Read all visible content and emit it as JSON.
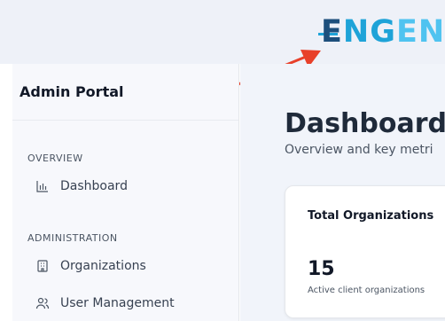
{
  "brand": {
    "logo_part1": "E",
    "logo_part2": "NG",
    "logo_part3": "EN"
  },
  "sidebar": {
    "title": "Admin Portal",
    "sections": [
      {
        "label": "OVERVIEW",
        "items": [
          {
            "label": "Dashboard",
            "icon": "bar-chart-icon"
          }
        ]
      },
      {
        "label": "ADMINISTRATION",
        "items": [
          {
            "label": "Organizations",
            "icon": "building-icon"
          },
          {
            "label": "User Management",
            "icon": "users-icon"
          }
        ]
      }
    ]
  },
  "main": {
    "title": "Dashboard",
    "subtitle": "Overview and key metri",
    "cards": [
      {
        "title": "Total Organizations",
        "value": "15",
        "caption": "Active client organizations"
      }
    ]
  },
  "annotation": {
    "arrow_color": "#e8402a"
  },
  "colors": {
    "accent": "#1ea3d8",
    "brand_dark": "#1d4f7c",
    "sidebar_bg": "#f7f8fc",
    "main_bg": "#f1f4fa"
  }
}
